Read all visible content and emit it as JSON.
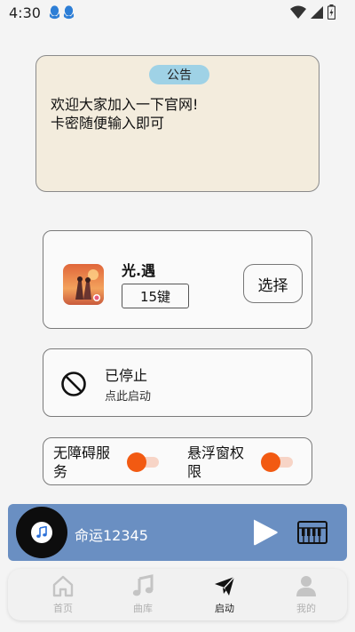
{
  "status_bar": {
    "time": "4:30"
  },
  "notice": {
    "badge": "公告",
    "line1": "欢迎大家加入一下官网!",
    "line2": "卡密随便输入即可"
  },
  "game": {
    "name": "光.遇",
    "keys": "15键",
    "select_label": "选择"
  },
  "run_status": {
    "title": "已停止",
    "subtitle": "点此启动"
  },
  "permissions": {
    "accessibility_label": "无障碍服务",
    "accessibility_enabled": true,
    "overlay_label": "悬浮窗权限",
    "overlay_enabled": true
  },
  "player": {
    "song_title": "命运12345",
    "disc_icon": "music-note-icon",
    "play_icon": "play-icon",
    "keyboard_icon": "piano-icon"
  },
  "nav": {
    "items": [
      {
        "label": "首页",
        "icon": "home-icon",
        "active": false
      },
      {
        "label": "曲库",
        "icon": "music-note-icon",
        "active": false
      },
      {
        "label": "启动",
        "icon": "send-icon",
        "active": true
      },
      {
        "label": "我的",
        "icon": "person-icon",
        "active": false
      }
    ]
  },
  "colors": {
    "accent": "#f25a12",
    "player_bg": "#6a8fc2",
    "notice_bg": "#f3ecdd",
    "badge_bg": "#9fd2e6"
  }
}
